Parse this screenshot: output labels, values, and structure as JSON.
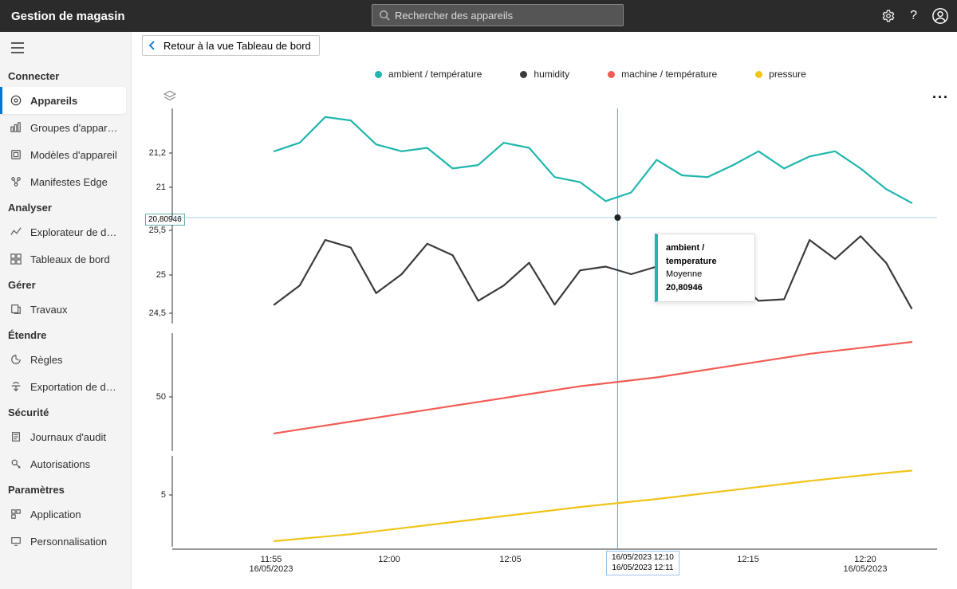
{
  "topbar": {
    "title": "Gestion de magasin",
    "search_placeholder": "Rechercher des appareils"
  },
  "sidebar": {
    "sections": [
      {
        "title": "Connecter",
        "items": [
          {
            "icon": "device",
            "label": "Appareils",
            "active": true
          },
          {
            "icon": "group",
            "label": "Groupes d'appareils"
          },
          {
            "icon": "template",
            "label": "Modèles d'appareil"
          },
          {
            "icon": "manifest",
            "label": "Manifestes Edge"
          }
        ]
      },
      {
        "title": "Analyser",
        "items": [
          {
            "icon": "explore",
            "label": "Explorateur de données"
          },
          {
            "icon": "dash",
            "label": "Tableaux de bord"
          }
        ]
      },
      {
        "title": "Gérer",
        "items": [
          {
            "icon": "jobs",
            "label": "Travaux"
          }
        ]
      },
      {
        "title": "Étendre",
        "items": [
          {
            "icon": "rules",
            "label": "Règles"
          },
          {
            "icon": "export",
            "label": "Exportation de don..."
          }
        ]
      },
      {
        "title": "Sécurité",
        "items": [
          {
            "icon": "audit",
            "label": "Journaux d'audit"
          },
          {
            "icon": "perm",
            "label": "Autorisations"
          }
        ]
      },
      {
        "title": "Paramètres",
        "items": [
          {
            "icon": "app",
            "label": "Application"
          },
          {
            "icon": "person",
            "label": "Personnalisation"
          }
        ]
      }
    ]
  },
  "back_button": "Retour à la vue Tableau de bord",
  "legend": [
    {
      "color": "#1fb6ad",
      "label": "ambient / température"
    },
    {
      "color": "#3b3b3b",
      "label": "humidity"
    },
    {
      "color": "#f25c54",
      "label": "machine / température"
    },
    {
      "color": "#f0c419",
      "label": "pressure"
    }
  ],
  "tooltip": {
    "title": "ambient / temperature",
    "stat": "Moyenne",
    "value": "20,80946"
  },
  "y_flag": "20,80946",
  "x_flag": {
    "line1": "16/05/2023 12:10",
    "line2": "16/05/2023 12:11"
  },
  "x_ticks": [
    {
      "t1": "11:55",
      "t2": "16/05/2023"
    },
    {
      "t1": "12:00",
      "t2": ""
    },
    {
      "t1": "12:05",
      "t2": ""
    },
    {
      "t1": "12:15",
      "t2": ""
    },
    {
      "t1": "12:20",
      "t2": "16/05/2023"
    }
  ],
  "panels_ylabels": {
    "p1": [
      "21,2",
      "21"
    ],
    "p2": [
      "25,5",
      "25",
      "24,5"
    ],
    "p3": [
      "50"
    ],
    "p4": [
      "5"
    ]
  },
  "chart_data": [
    {
      "type": "line",
      "name": "ambient / température",
      "color": "#1fb6ad",
      "ylim": [
        20.7,
        21.35
      ],
      "x": [
        "11:57",
        "11:58",
        "11:59",
        "12:00",
        "12:01",
        "12:02",
        "12:03",
        "12:04",
        "12:05",
        "12:06",
        "12:07",
        "12:08",
        "12:09",
        "12:10",
        "12:11",
        "12:12",
        "12:13",
        "12:14",
        "12:15",
        "12:16",
        "12:17",
        "12:18",
        "12:19",
        "12:20",
        "12:21",
        "12:22"
      ],
      "values": [
        21.1,
        21.15,
        21.3,
        21.28,
        21.14,
        21.1,
        21.12,
        21.0,
        21.02,
        21.15,
        21.12,
        20.95,
        20.92,
        20.81,
        20.86,
        21.05,
        20.96,
        20.95,
        21.02,
        21.1,
        21.0,
        21.07,
        21.1,
        21.0,
        20.88,
        20.8
      ]
    },
    {
      "type": "line",
      "name": "humidity",
      "color": "#3b3b3b",
      "ylim": [
        24.3,
        25.6
      ],
      "x": [
        "11:57",
        "11:58",
        "11:59",
        "12:00",
        "12:01",
        "12:02",
        "12:03",
        "12:04",
        "12:05",
        "12:06",
        "12:07",
        "12:08",
        "12:09",
        "12:10",
        "12:11",
        "12:12",
        "12:13",
        "12:14",
        "12:15",
        "12:16",
        "12:17",
        "12:18",
        "12:19",
        "12:20",
        "12:21",
        "12:22"
      ],
      "values": [
        24.55,
        24.8,
        25.4,
        25.3,
        24.7,
        24.95,
        25.35,
        25.2,
        24.6,
        24.8,
        25.1,
        24.55,
        25.0,
        25.05,
        24.95,
        25.05,
        25.0,
        24.95,
        24.9,
        24.6,
        24.62,
        25.4,
        25.15,
        25.45,
        25.1,
        24.5
      ]
    },
    {
      "type": "line",
      "name": "machine / température",
      "color": "#f25c54",
      "ylim": [
        30,
        70
      ],
      "x": [
        "11:57",
        "12:00",
        "12:03",
        "12:06",
        "12:09",
        "12:12",
        "12:15",
        "12:18",
        "12:21",
        "12:22"
      ],
      "values": [
        36,
        40,
        44,
        48,
        52,
        55,
        59,
        63,
        66,
        67
      ]
    },
    {
      "type": "line",
      "name": "pressure",
      "color": "#f0c419",
      "ylim": [
        1,
        9
      ],
      "x": [
        "11:57",
        "12:00",
        "12:03",
        "12:06",
        "12:09",
        "12:12",
        "12:15",
        "12:18",
        "12:21",
        "12:22"
      ],
      "values": [
        1.5,
        2.1,
        2.9,
        3.7,
        4.5,
        5.2,
        6.0,
        6.8,
        7.5,
        7.7
      ]
    }
  ]
}
